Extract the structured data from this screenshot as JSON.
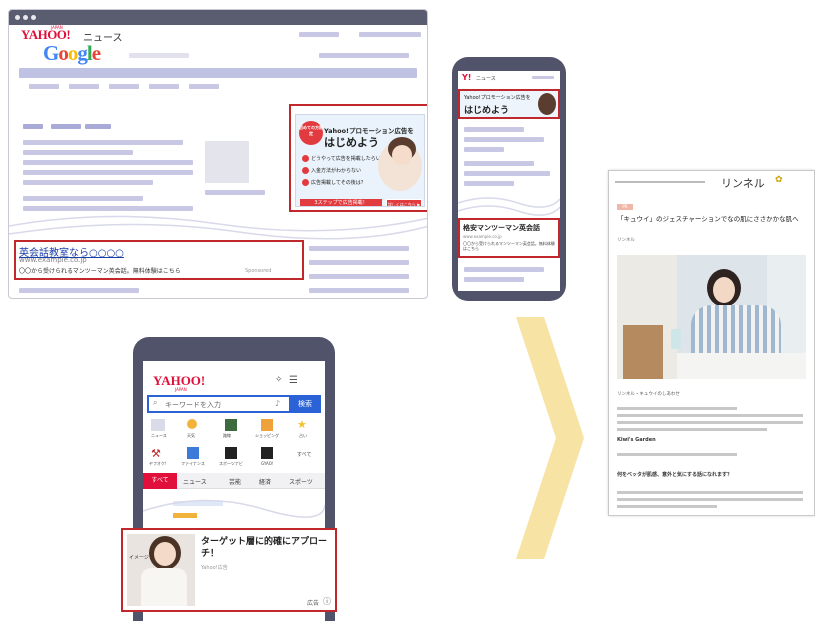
{
  "desktop": {
    "yahoo_logo": "YAHOO!",
    "yahoo_japan": "JAPAN",
    "news_label": "ニュース",
    "google_logo": [
      "G",
      "o",
      "o",
      "g",
      "l",
      "e"
    ],
    "display_ad": {
      "badge": "初めての方限定",
      "headline_small": "Yahoo!プロモーション広告を",
      "headline_large": "はじめよう",
      "steps": [
        "どうやって広告を掲載したらいいの？",
        "入金方法がわからない",
        "広告掲載してその後は？"
      ],
      "cta": "3ステップで広告掲載！",
      "cta2": "詳しくはこちら ▶"
    },
    "search_ad": {
      "title": "英会話教室なら○○○○",
      "url": "www.example.co.jp",
      "description": "〇〇から受けられるマンツーマン英会話。無料体験はこちら",
      "note": "Sponsored"
    }
  },
  "phone_top": {
    "header_logo": "Y!",
    "header_label": "ニュース",
    "banner_small": "Yahoo!プロモーション広告を",
    "banner_large": "はじめよう",
    "ad_title": "格安マンツーマン英会話",
    "ad_url": "www.example.co.jp",
    "ad_desc": "〇〇から受けられるマンツーマン英会話。無料体験はこちら"
  },
  "phone_bottom": {
    "logo": "YAHOO!",
    "logo_sub": "JAPAN",
    "search_placeholder": "キーワードを入力",
    "search_button": "検索",
    "icons_row1": [
      "ニュース",
      "天気",
      "路線",
      "ショッピング",
      "占い"
    ],
    "icons_row2": [
      "ヤフオク!",
      "ファイナンス",
      "スポーツナビ",
      "GYAO!",
      "すべて"
    ],
    "tabs": [
      "すべて",
      "ニュース",
      "芸能",
      "経済",
      "スポーツ"
    ],
    "ad_title": "ターゲット層に的確にアプローチ！",
    "ad_sponsor": "Yahoo!広告",
    "ad_label": "広告",
    "ad_image_caption": "イメージ"
  },
  "article": {
    "site_logo": "リンネル",
    "category": "PR",
    "title": "「キュウイ」のジェスチャーションでなの肌にささかかな肌へ",
    "author": "リンネル",
    "caption": "リンネル・キュウイのしあわせ",
    "brand_label": "Kiwi's Garden",
    "subheading": "何をベッタが肌感、意外と気にする話になれます？",
    "colors": {
      "brand": "#e0103a",
      "frame": "#c0282c",
      "arrow": "#f7e3a4"
    }
  }
}
